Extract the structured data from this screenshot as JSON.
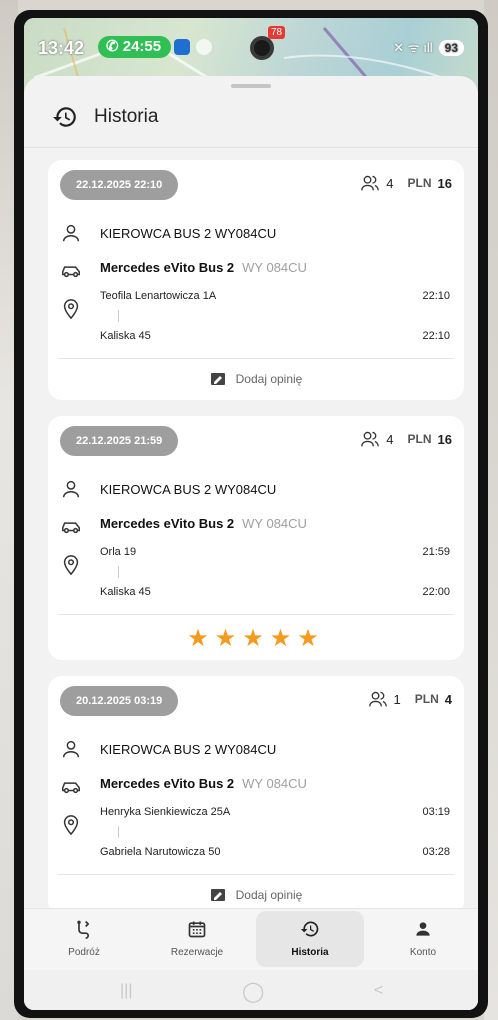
{
  "status_bar": {
    "time": "13:42",
    "call_timer": "24:55",
    "battery": "93",
    "notification_badge": "78"
  },
  "header": {
    "title": "Historia",
    "icon": "history-icon"
  },
  "rides": [
    {
      "date": "22.12.2025 22:10",
      "passengers": "4",
      "currency": "PLN",
      "price": "16",
      "driver": "KIEROWCA BUS 2 WY084CU",
      "vehicle": "Mercedes eVito Bus 2",
      "plate": "WY 084CU",
      "from": "Teofila Lenartowicza 1A",
      "from_time": "22:10",
      "to": "Kaliska 45",
      "to_time": "22:10",
      "action_label": "Dodaj opinię"
    },
    {
      "date": "22.12.2025 21:59",
      "passengers": "4",
      "currency": "PLN",
      "price": "16",
      "driver": "KIEROWCA BUS 2 WY084CU",
      "vehicle": "Mercedes eVito Bus 2",
      "plate": "WY 084CU",
      "from": "Orla 19",
      "from_time": "21:59",
      "to": "Kaliska 45",
      "to_time": "22:00",
      "rating": 5,
      "rating_stars": "★★★★★"
    },
    {
      "date": "20.12.2025 03:19",
      "passengers": "1",
      "currency": "PLN",
      "price": "4",
      "driver": "KIEROWCA BUS 2 WY084CU",
      "vehicle": "Mercedes eVito Bus 2",
      "plate": "WY 084CU",
      "from": "Henryka Sienkiewicza 25A",
      "from_time": "03:19",
      "to": "Gabriela Narutowicza 50",
      "to_time": "03:28",
      "action_label": "Dodaj opinię"
    }
  ],
  "bottom_nav": [
    {
      "label": "Podróż",
      "icon": "route-icon"
    },
    {
      "label": "Rezerwacje",
      "icon": "calendar-icon"
    },
    {
      "label": "Historia",
      "icon": "history-icon",
      "active": true
    },
    {
      "label": "Konto",
      "icon": "person-icon"
    }
  ],
  "colors": {
    "accent_star": "#f59a1c",
    "pill": "#9e9e9e",
    "call": "#2fbf55"
  }
}
